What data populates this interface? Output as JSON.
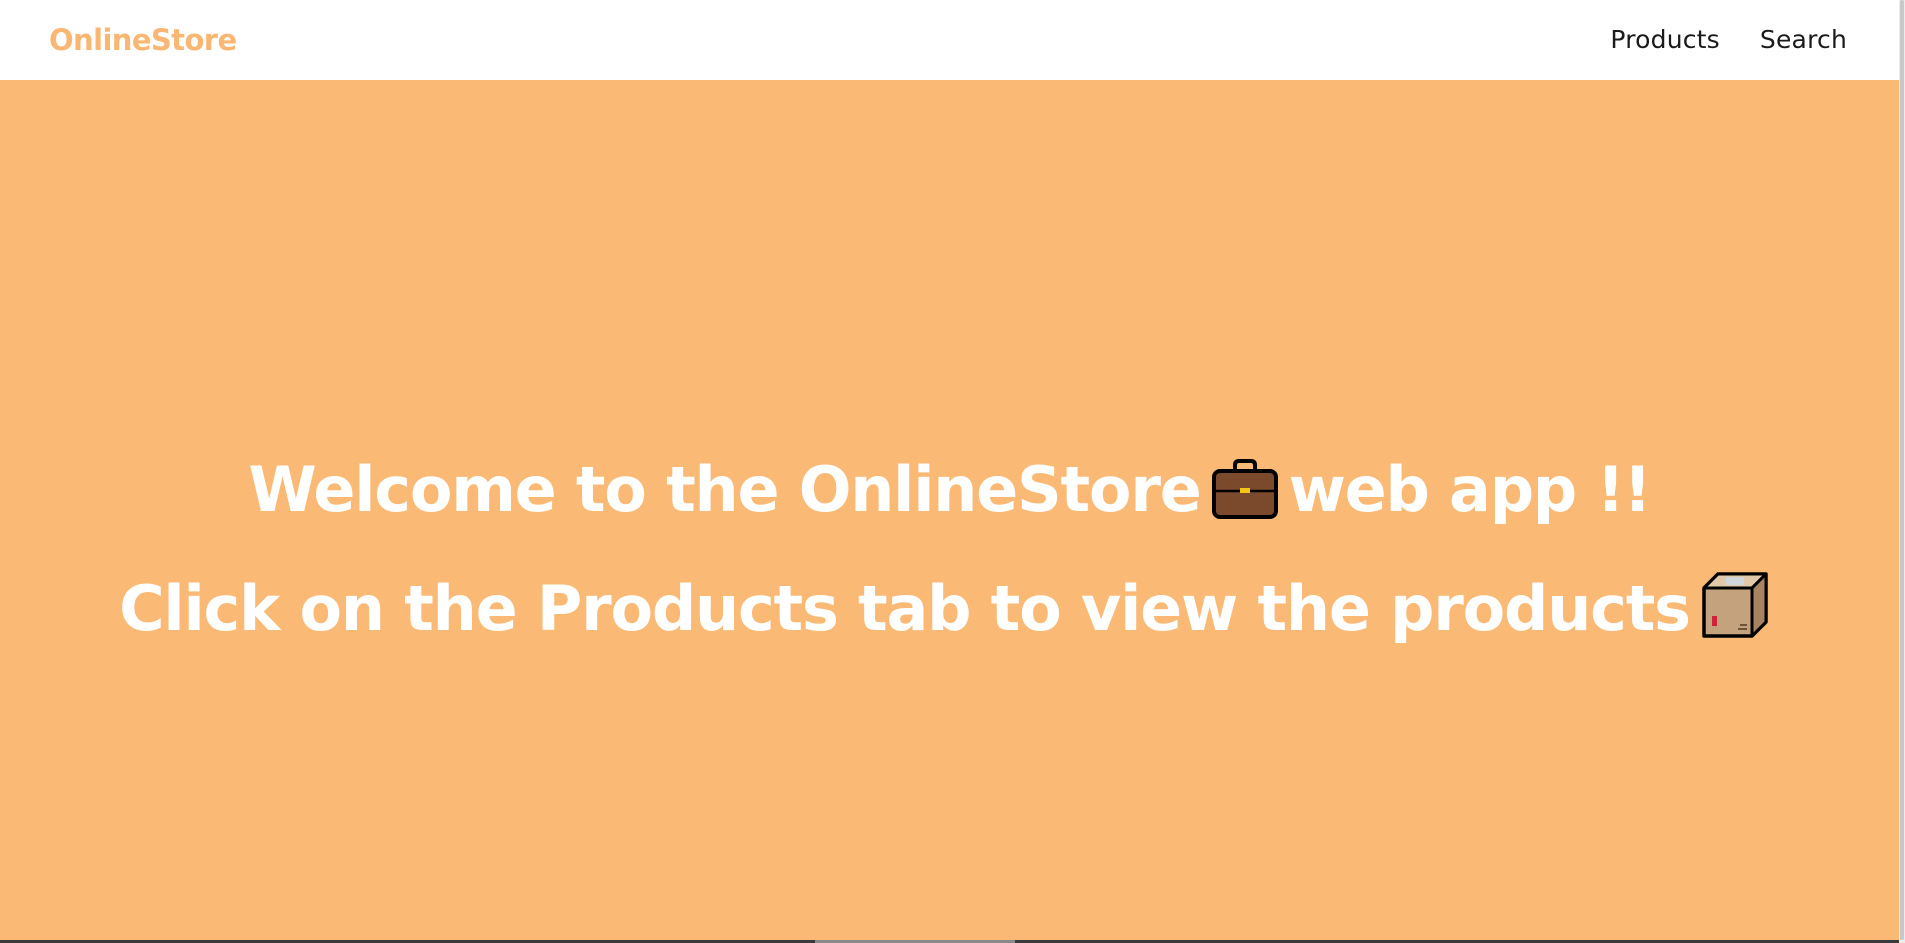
{
  "navbar": {
    "brand": "OnlineStore",
    "links": [
      {
        "label": "Products"
      },
      {
        "label": "Search"
      }
    ]
  },
  "hero": {
    "line1_before": "Welcome to the OnlineStore",
    "line1_icon": "briefcase-icon",
    "line1_after": "web app !!",
    "line2_before": "Click on the Products tab to view the products",
    "line2_icon": "package-box-icon"
  },
  "colors": {
    "accent": "#f9b773",
    "hero_background": "#fab974",
    "hero_text": "#ffffff",
    "nav_text": "#1a1a1a"
  }
}
